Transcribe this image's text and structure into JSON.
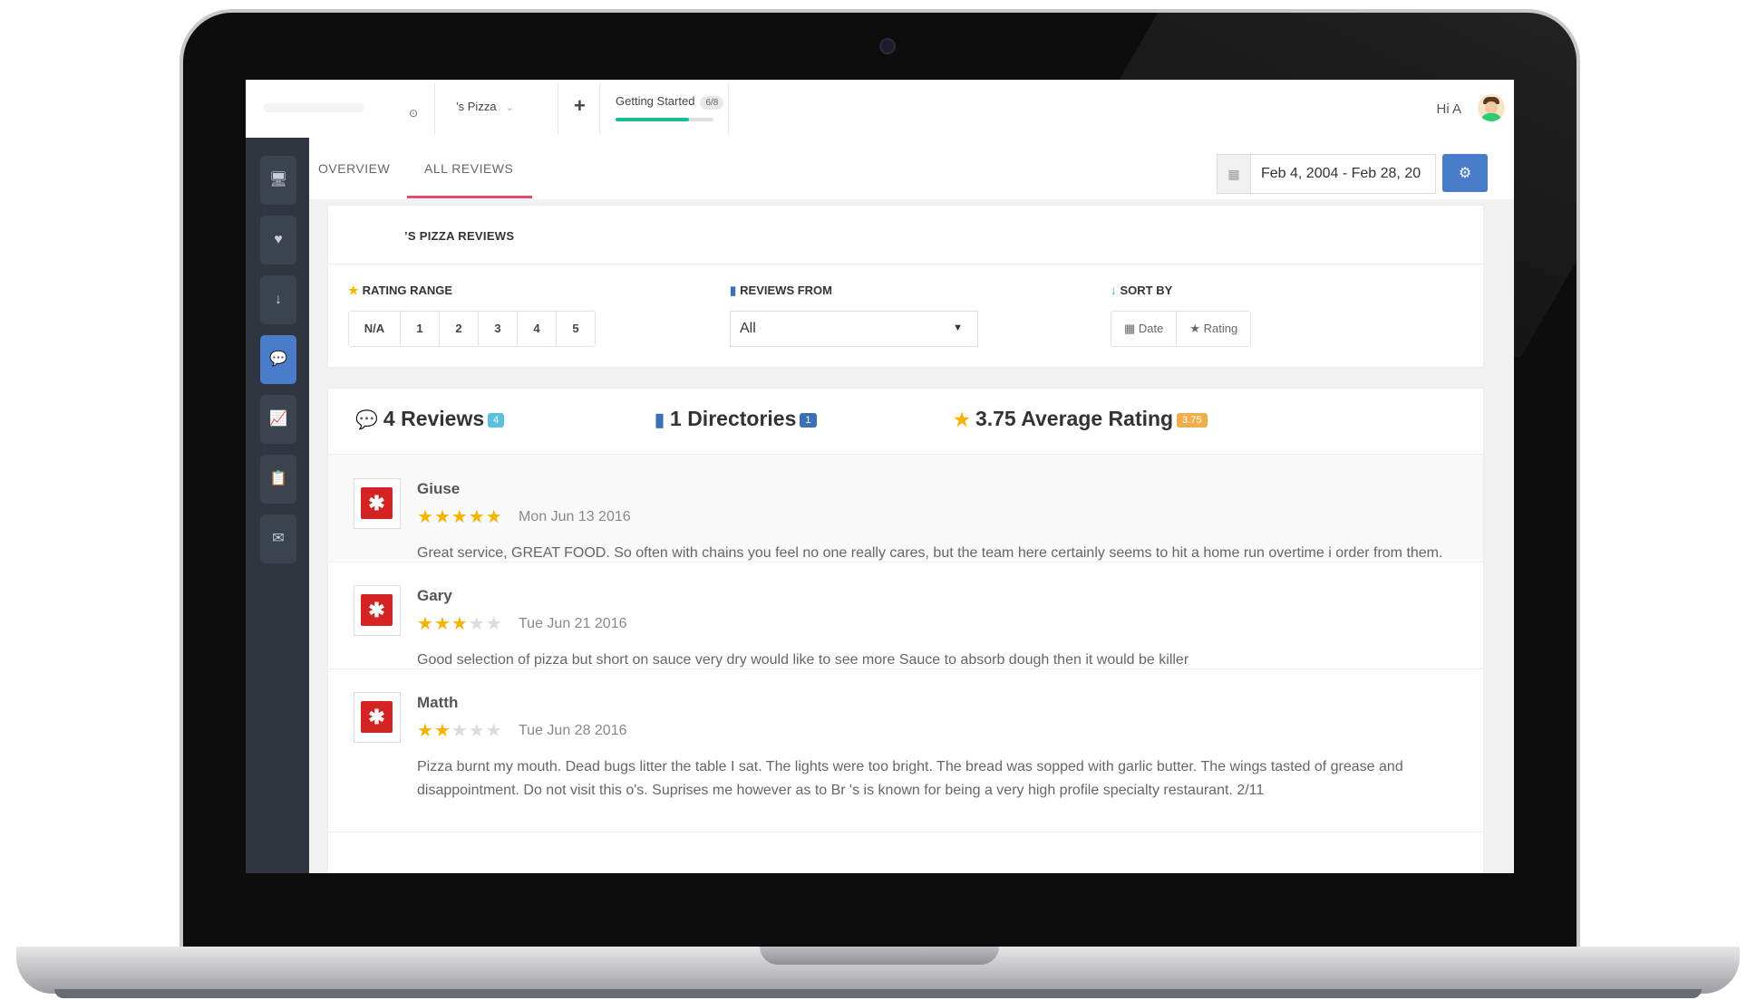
{
  "topbar": {
    "location": "’s Pizza",
    "getting_started": "Getting Started",
    "progress_badge": "6/8",
    "progress_fraction": 0.75,
    "greeting": "Hi A"
  },
  "icons": {
    "plus": "+",
    "pin": "⊙",
    "chevron": "⌄",
    "sidebar": [
      "desktop-icon",
      "heart-icon",
      "sort-numeric-icon",
      "comments-icon",
      "chart-line-icon",
      "clipboard-icon",
      "envelope-icon"
    ]
  },
  "tabs": {
    "overview": "OVERVIEW",
    "all_reviews": "ALL REVIEWS"
  },
  "date_range": {
    "value": "Feb 4, 2004 - Feb 28, 20"
  },
  "filters": {
    "title": "’S PIZZA REVIEWS",
    "rating_range_label": "RATING RANGE",
    "rating_options": [
      "N/A",
      "1",
      "2",
      "3",
      "4",
      "5"
    ],
    "reviews_from_label": "REVIEWS FROM",
    "reviews_from_value": "All",
    "sort_by_label": "SORT BY",
    "sort_options": [
      "Date",
      "Rating"
    ]
  },
  "stats": {
    "reviews": {
      "label": "4 Reviews",
      "badge": "4",
      "badge_color": "#5bc0de"
    },
    "directories": {
      "label": "1 Directories",
      "badge": "1",
      "badge_color": "#3b6fb6"
    },
    "average": {
      "label": "3.75 Average Rating",
      "badge": "3.75",
      "badge_color": "#f0ad4e"
    }
  },
  "reviews": [
    {
      "name": "Giuse",
      "rating": 5,
      "date": "Mon Jun 13 2016",
      "text": "Great service, GREAT FOOD.  So often with chains you feel no one really cares, but the team here certainly seems to hit a home run overtime i order from them."
    },
    {
      "name": "Gary",
      "rating": 3,
      "date": "Tue Jun 21 2016",
      "text": "Good selection of pizza but short on sauce very dry would like to see more Sauce to absorb dough then it would be killer"
    },
    {
      "name": "Matth",
      "rating": 2,
      "date": "Tue Jun 28 2016",
      "text": "Pizza burnt my mouth. Dead bugs litter the table I sat. The lights were too bright. The bread was sopped with garlic butter. The wings tasted of grease and disappointment. Do not visit this        o's. Suprises me however as to Br       's is known for being a very high profile specialty restaurant. 2/11"
    }
  ],
  "colors": {
    "accent": "#4a7cc9",
    "tab_underline": "#e74c6a",
    "progress": "#1abc9c",
    "star": "#f5b301",
    "yelp": "#d32323",
    "sidebar_bg": "#2f3640"
  }
}
